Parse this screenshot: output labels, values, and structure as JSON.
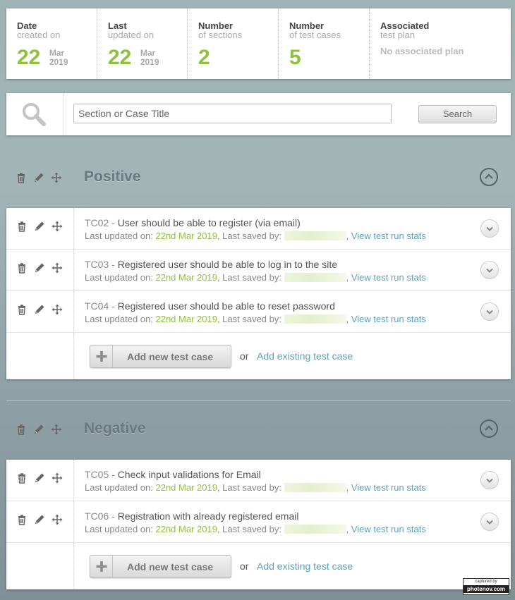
{
  "stats": {
    "date_created": {
      "label": "Date",
      "sublabel": "created on",
      "day": "22",
      "month": "Mar",
      "year": "2019"
    },
    "last_updated": {
      "label": "Last",
      "sublabel": "updated on",
      "day": "22",
      "month": "Mar",
      "year": "2019"
    },
    "sections": {
      "label": "Number",
      "sublabel": "of sections",
      "value": "2"
    },
    "test_cases": {
      "label": "Number",
      "sublabel": "of test cases",
      "value": "5"
    },
    "plan": {
      "label": "Associated",
      "sublabel": "test plan",
      "value": "No associated plan"
    }
  },
  "search": {
    "placeholder": "Section or Case Title",
    "button_label": "Search"
  },
  "colors": {
    "accent_green": "#8fc13e",
    "link_blue": "#5aa1c8"
  },
  "sections": [
    {
      "title": "Positive",
      "cases": [
        {
          "id": "TC02",
          "sep": " - ",
          "title": "User should be able to register (via email)",
          "updated_prefix": "Last updated on: ",
          "date": "22nd Mar 2019",
          "saved_prefix": ", Last saved by: ",
          "comma": ", ",
          "stats_link": "View test run stats"
        },
        {
          "id": "TC03",
          "sep": " - ",
          "title": "Registered user should be able to log in to the site",
          "updated_prefix": "Last updated on: ",
          "date": "22nd Mar 2019",
          "saved_prefix": ", Last saved by: ",
          "comma": ", ",
          "stats_link": "View test run stats"
        },
        {
          "id": "TC04",
          "sep": " - ",
          "title": "Registered user should be able to reset password",
          "updated_prefix": "Last updated on: ",
          "date": "22nd Mar 2019",
          "saved_prefix": ", Last saved by: ",
          "comma": ", ",
          "stats_link": "View test run stats"
        }
      ],
      "add_button": "Add new test case",
      "or": "or",
      "add_existing": "Add existing test case"
    },
    {
      "title": "Negative",
      "cases": [
        {
          "id": "TC05",
          "sep": " - ",
          "title": "Check input validations for Email",
          "updated_prefix": "Last updated on: ",
          "date": "22nd Mar 2019",
          "saved_prefix": ", Last saved by: ",
          "comma": ", ",
          "stats_link": "View test run stats"
        },
        {
          "id": "TC06",
          "sep": " - ",
          "title": "Registration with already registered email",
          "updated_prefix": "Last updated on: ",
          "date": "22nd Mar 2019",
          "saved_prefix": ", Last saved by: ",
          "comma": ", ",
          "stats_link": "View test run stats"
        }
      ],
      "add_button": "Add new test case",
      "or": "or",
      "add_existing": "Add existing test case"
    }
  ],
  "watermark": {
    "line1": "captured by",
    "line2": "photenov.com"
  },
  "icons": [
    "trash-icon",
    "pencil-icon",
    "move-icon",
    "search-icon",
    "chevron-up-icon",
    "chevron-down-icon",
    "plus-icon"
  ]
}
